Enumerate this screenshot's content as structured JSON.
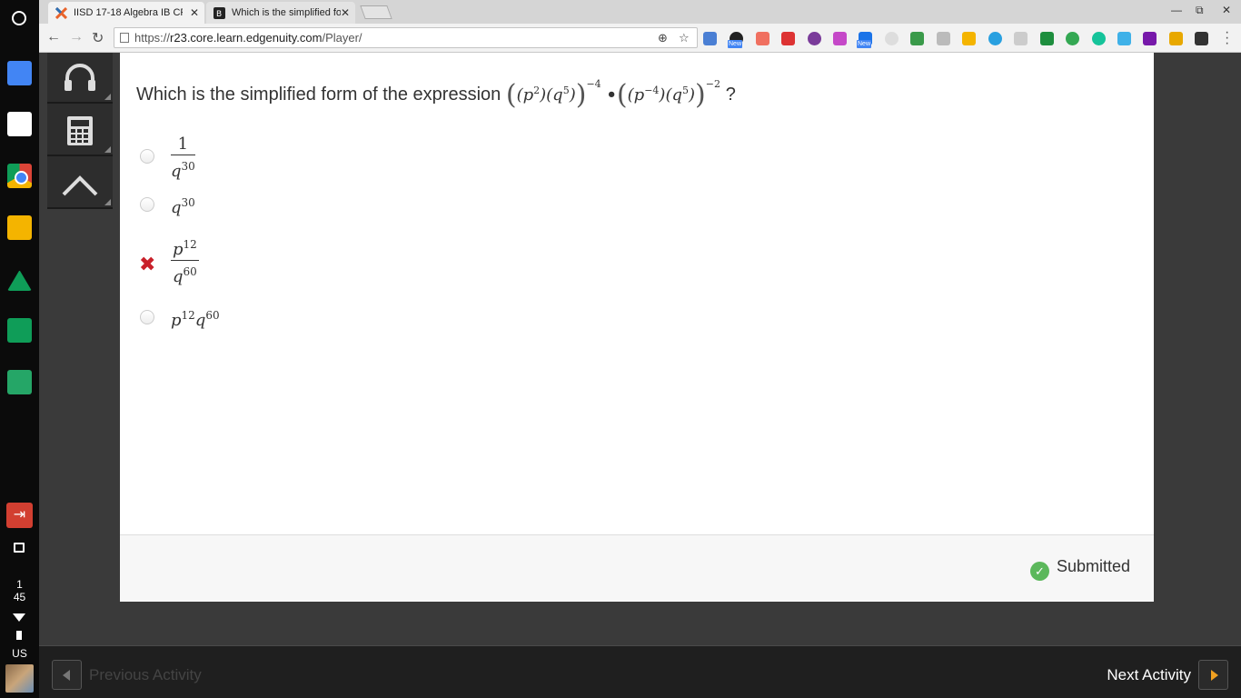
{
  "browser": {
    "tabs": [
      {
        "label": "IISD 17-18 Algebra IB CR",
        "active": true
      },
      {
        "label": "Which is the simplified fo",
        "active": false
      }
    ],
    "url_scheme": "https://",
    "url_host": "r23.core.learn.edgenuity.com",
    "url_path": "/Player/",
    "extension_badge": "New"
  },
  "shelf": {
    "clock_hour": "1",
    "clock_minute": "45",
    "locale": "US"
  },
  "question": {
    "prompt": "Which is the simplified form of the expression",
    "expression": {
      "left_base1": "p",
      "left_exp1": "2",
      "left_base2": "q",
      "left_exp2": "5",
      "left_outer_exp": "−4",
      "operator": "•",
      "right_base1": "p",
      "right_exp1": "−4",
      "right_base2": "q",
      "right_exp2": "5",
      "right_outer_exp": "−2"
    },
    "question_mark": "?"
  },
  "options": [
    {
      "num": "1",
      "den_base": "q",
      "den_exp": "30",
      "state": "unselected"
    },
    {
      "base": "q",
      "exp": "30",
      "state": "unselected"
    },
    {
      "num_base": "p",
      "num_exp": "12",
      "den_base": "q",
      "den_exp": "60",
      "state": "incorrect"
    },
    {
      "base1": "p",
      "exp1": "12",
      "base2": "q",
      "exp2": "60",
      "state": "unselected"
    }
  ],
  "status": {
    "label": "Submitted",
    "color": "#5cb85c"
  },
  "navigation": {
    "prev_label": "Previous Activity",
    "next_label": "Next Activity",
    "next_accent": "#f0a020"
  }
}
